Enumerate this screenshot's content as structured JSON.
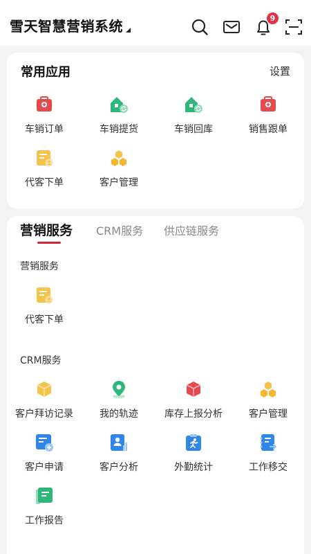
{
  "header": {
    "app_title": "雪天智慧营销系统",
    "notification_count": "9"
  },
  "common_apps": {
    "title": "常用应用",
    "settings_label": "设置",
    "items": [
      {
        "label": "车销订单",
        "icon": "red-kit-icon"
      },
      {
        "label": "车销提货",
        "icon": "green-house-icon"
      },
      {
        "label": "车销回库",
        "icon": "green-house-icon"
      },
      {
        "label": "销售跟单",
        "icon": "red-kit-icon"
      },
      {
        "label": "代客下单",
        "icon": "yellow-doc-icon"
      },
      {
        "label": "客户管理",
        "icon": "yellow-hex-icon"
      }
    ]
  },
  "services": {
    "tabs": [
      {
        "label": "营销服务",
        "active": true
      },
      {
        "label": "CRM服务",
        "active": false
      },
      {
        "label": "供应链服务",
        "active": false
      }
    ],
    "marketing_section": {
      "title": "营销服务",
      "items": [
        {
          "label": "代客下单",
          "icon": "yellow-doc-icon"
        }
      ]
    },
    "crm_section": {
      "title": "CRM服务",
      "items": [
        {
          "label": "客户拜访记录",
          "icon": "yellow-box-icon"
        },
        {
          "label": "我的轨迹",
          "icon": "green-pin-icon"
        },
        {
          "label": "库存上报分析",
          "icon": "red-box-icon"
        },
        {
          "label": "客户管理",
          "icon": "yellow-hex-icon"
        },
        {
          "label": "客户申请",
          "icon": "blue-add-doc-icon"
        },
        {
          "label": "客户分析",
          "icon": "blue-person-chart-icon"
        },
        {
          "label": "外勤统计",
          "icon": "blue-runner-icon"
        },
        {
          "label": "工作移交",
          "icon": "blue-notebook-icon"
        },
        {
          "label": "工作报告",
          "icon": "green-book-icon"
        }
      ]
    }
  },
  "colors": {
    "accent": "#d1263a",
    "badge": "#e0334a",
    "green": "#2fb67a",
    "blue": "#2f86e8",
    "yellow": "#f6c34a",
    "red": "#e5484d"
  }
}
